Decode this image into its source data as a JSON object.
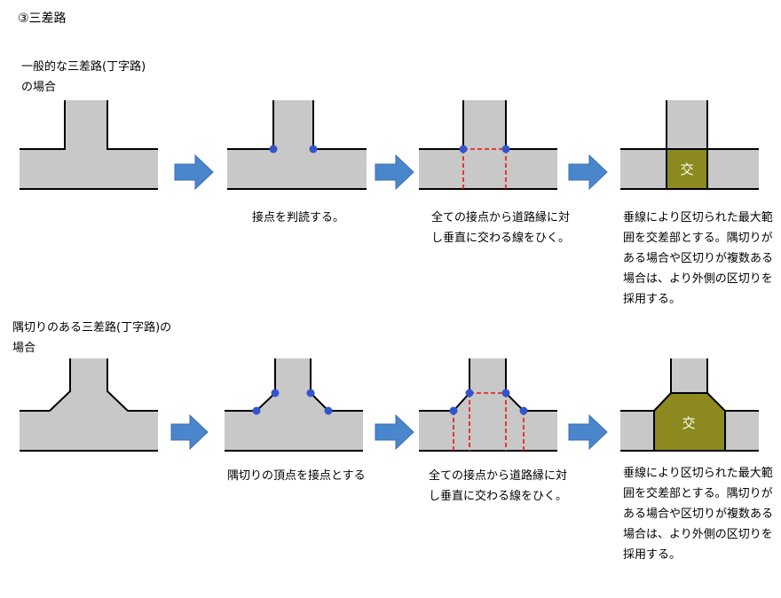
{
  "title": "③三差路",
  "sections": [
    {
      "caption": "一般的な三差路(丁字路)\nの場合",
      "steps": [
        "接点を判読する。",
        "全ての接点から道路縁に対し垂直に交わる線をひく。",
        "垂線により区切られた最大範囲を交差部とする。隅切りがある場合や区切りが複数ある場合は、より外側の区切りを採用する。"
      ]
    },
    {
      "caption": "隅切りのある三差路(丁字路)の\n場合",
      "steps": [
        "隅切りの頂点を接点とする",
        "全ての接点から道路縁に対し垂直に交わる線をひく。",
        "垂線により区切られた最大範囲を交差部とする。隅切りがある場合や区切りが複数ある場合は、より外側の区切りを採用する。"
      ]
    }
  ],
  "intersection_label": "交",
  "colors": {
    "road": "#c8c8c8",
    "edge": "#000000",
    "point": "#3355cc",
    "perpendicular": "#ee1111",
    "intersection": "#8c8a1e",
    "arrow": "#4a86cc"
  }
}
